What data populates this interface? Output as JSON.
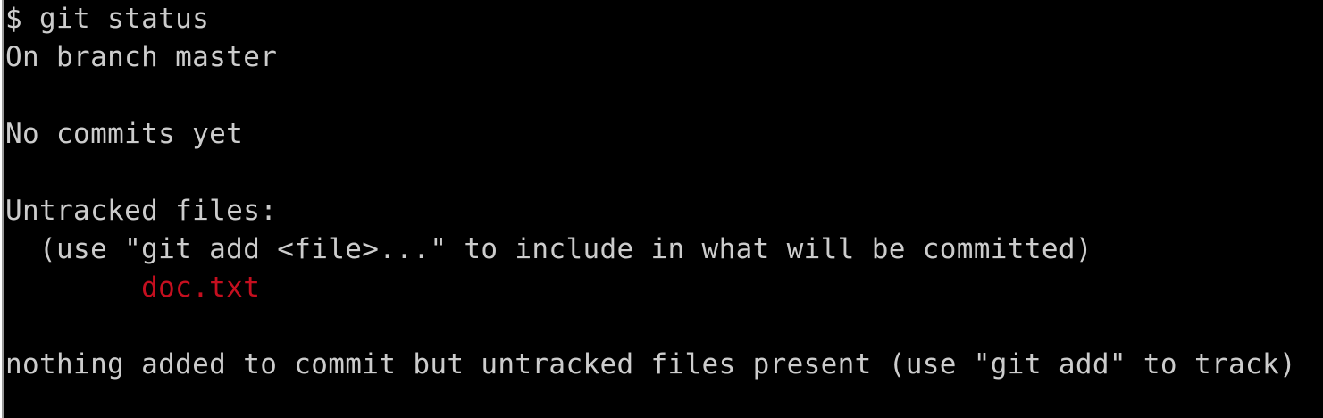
{
  "terminal": {
    "colors": {
      "background": "#000000",
      "foreground": "#cccccc",
      "untracked": "#c50f1f"
    },
    "lines": [
      {
        "text": "$ git status",
        "kind": "command"
      },
      {
        "text": "On branch master",
        "kind": "output"
      },
      {
        "text": "",
        "kind": "blank"
      },
      {
        "text": "No commits yet",
        "kind": "output"
      },
      {
        "text": "",
        "kind": "blank"
      },
      {
        "text": "Untracked files:",
        "kind": "output"
      },
      {
        "text": "  (use \"git add <file>...\" to include in what will be committed)",
        "kind": "hint"
      },
      {
        "text": "        doc.txt",
        "kind": "untracked-file"
      },
      {
        "text": "",
        "kind": "blank"
      },
      {
        "text": "nothing added to commit but untracked files present (use \"git add\" to track)",
        "kind": "output"
      }
    ]
  }
}
